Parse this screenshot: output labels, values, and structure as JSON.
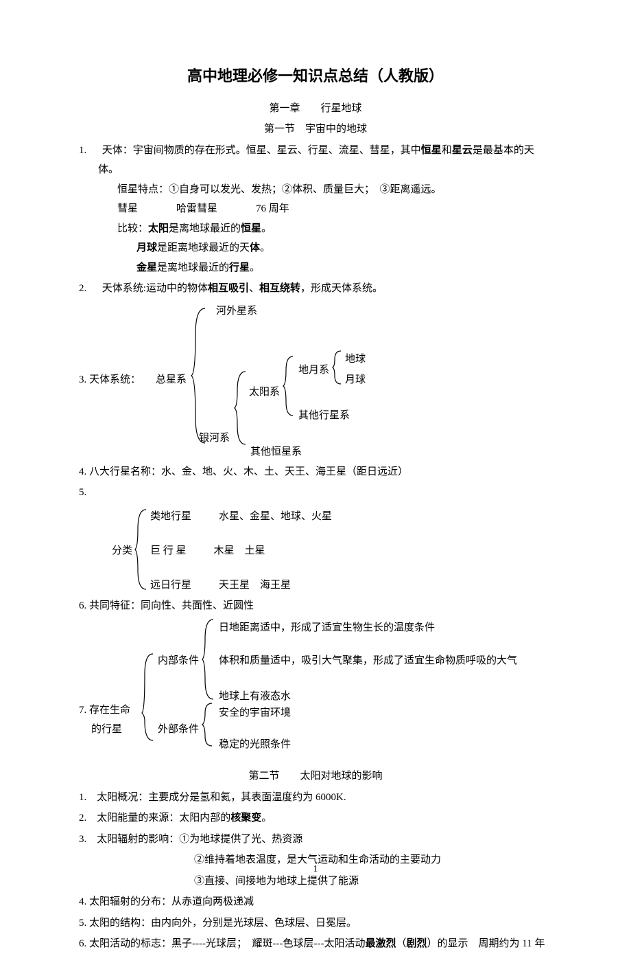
{
  "title": "高中地理必修一知识点总结（人教版）",
  "chapter": "第一章　　行星地球",
  "section1": "第一节　宇宙中的地球",
  "p1_num": "1.",
  "p1_label": "天体：",
  "p1_text": "宇宙间物质的存在形式。恒星、星云、行星、流星、彗星，其中",
  "p1_bold1": "恒星",
  "p1_mid": "和",
  "p1_bold2": "星云",
  "p1_tail": "是最基本的天体。",
  "p1_sub1": "恒星特点：①自身可以发光、发热；②体积、质量巨大；　③距离遥远。",
  "p1_sub2_a": "彗星",
  "p1_sub2_b": "哈雷彗星",
  "p1_sub2_c": "76 周年",
  "p1_cmp_label": "比较：",
  "p1_cmp1_a": "太阳",
  "p1_cmp1_b": "是离地球最近的",
  "p1_cmp1_c": "恒星",
  "p1_cmp1_d": "。",
  "p1_cmp2_a": "月球",
  "p1_cmp2_b": "是距离地球最近的天",
  "p1_cmp2_c": "体",
  "p1_cmp2_d": "。",
  "p1_cmp3_a": "金星",
  "p1_cmp3_b": "是离地球最近的",
  "p1_cmp3_c": "行星",
  "p1_cmp3_d": "。",
  "p2_num": "2.",
  "p2_label": "天体系统:",
  "p2_text_a": "运动中的物体",
  "p2_bold1": "相互吸引",
  "p2_sep": "、",
  "p2_bold2": "相互绕转",
  "p2_text_b": "，形成天体系统。",
  "p3_label": "3. 天体系统：",
  "p3_total": "总星系",
  "p3_extra": "河外星系",
  "p3_milky": "银河系",
  "p3_solar": "太阳系",
  "p3_em": "地月系",
  "p3_earth": "地球",
  "p3_moon": "月球",
  "p3_other_planet": "其他行星系",
  "p3_other_star": "其他恒星系",
  "p4": "4. 八大行星名称：水、金、地、火、木、土、天王、海王星（距日远近）",
  "p5": "5.",
  "p5_classify": "分类",
  "p5_row1_a": "类地行星",
  "p5_row1_b": "水星、金星、地球、火星",
  "p5_row2_a": "巨 行 星",
  "p5_row2_b": "木星　土星",
  "p5_row3_a": "远日行星",
  "p5_row3_b": "天王星　海王星",
  "p6": "6. 共同特征：同向性、共面性、近圆性",
  "p7_label_a": "7. 存在生命",
  "p7_label_b": "的行星",
  "p7_inner": "内部条件",
  "p7_outer": "外部条件",
  "p7_i1": "日地距离适中，形成了适宜生物生长的温度条件",
  "p7_i2": "体积和质量适中，吸引大气聚集，形成了适宜生命物质呼吸的大气",
  "p7_i3": "地球上有液态水",
  "p7_o1": "安全的宇宙环境",
  "p7_o2": "稳定的光照条件",
  "section2": "第二节　　太阳对地球的影响",
  "s2_p1": "太阳概况：主要成分是氢和氦，其表面温度约为 6000K.",
  "s2_p1_num": "1.",
  "s2_p2_num": "2.",
  "s2_p2_a": "太阳能量的来源：太阳内部的",
  "s2_p2_b": "核聚变",
  "s2_p2_c": "。",
  "s2_p3_num": "3.",
  "s2_p3": "太阳辐射的影响：①为地球提供了光、热资源",
  "s2_p3_2": "②维持着地表温度，是大气运动和生命活动的主要动力",
  "s2_p3_3": "③直接、间接地为地球上提供了能源",
  "s2_p4": "4. 太阳辐射的分布：从赤道向两极递减",
  "s2_p5": "5. 太阳的结构：由内向外，分别是光球层、色球层、日冕层。",
  "s2_p6_a": "6. 太阳活动的标志：黑子----光球层；　耀斑---色球层---太阳活动",
  "s2_p6_b": "最激烈",
  "s2_p6_c": "（",
  "s2_p6_d": "剧烈",
  "s2_p6_e": "）的显示　周期约为 11 年",
  "page_number": "1"
}
